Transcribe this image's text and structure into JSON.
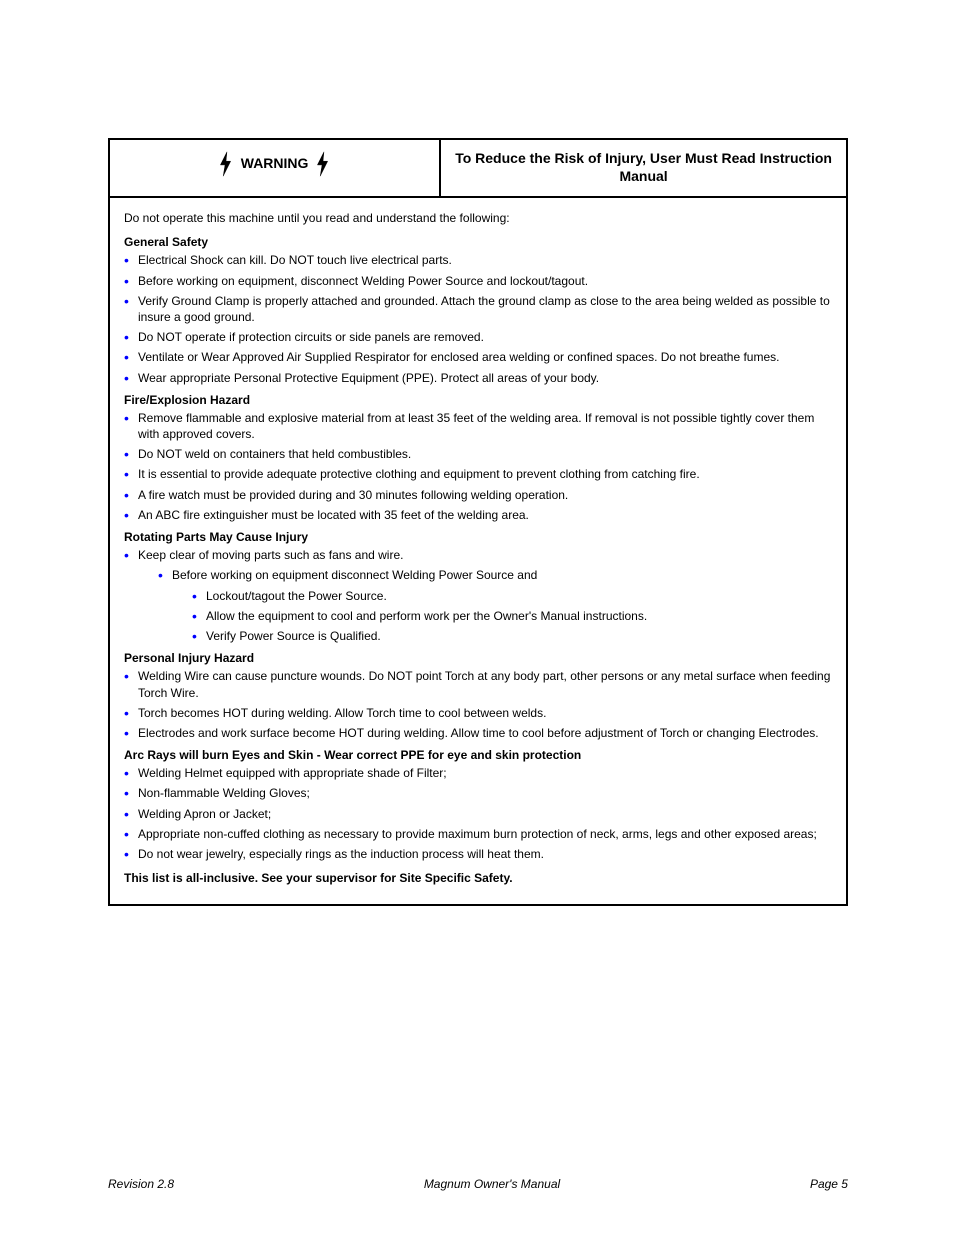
{
  "header": {
    "warning_label": "WARNING",
    "right_label": "To Reduce the Risk of Injury, User Must Read Instruction Manual"
  },
  "intro": "Do not operate this machine until you read and understand the following:",
  "section_general": {
    "title": "General Safety",
    "items": [
      "Electrical Shock can kill. Do NOT touch live electrical parts.",
      "Before working on equipment, disconnect Welding Power Source and lockout/tagout.",
      "Verify Ground Clamp is properly attached and grounded. Attach the ground clamp as close to the area being welded as possible to insure a good ground.",
      "Do NOT operate if protection circuits or side panels are removed.",
      "Ventilate or Wear Approved Air Supplied Respirator for enclosed area welding or confined spaces. Do not breathe fumes.",
      "Wear appropriate Personal Protective Equipment (PPE). Protect all areas of your body."
    ]
  },
  "section_fire": {
    "title": "Fire/Explosion Hazard",
    "items": [
      "Remove flammable and explosive material from at least 35 feet of the welding area. If removal is not possible tightly cover them with approved covers.",
      "Do NOT weld on containers that held combustibles.",
      "It is essential to provide adequate protective clothing and equipment to prevent clothing from catching fire.",
      "A fire watch must be provided during and 30 minutes following welding operation.",
      "An ABC fire extinguisher must be located with 35 feet of the welding area."
    ]
  },
  "section_rotating": {
    "title": "Rotating Parts May Cause Injury",
    "sub": {
      "item": "Keep clear of moving parts such as fans and wire.",
      "item_nested": "Before working on equipment disconnect Welding Power Source and",
      "subitems": [
        "Lockout/tagout the Power Source.",
        "Allow the equipment to cool and perform work per the Owner's Manual instructions.",
        "Verify Power Source is Qualified."
      ]
    }
  },
  "section_injury": {
    "title": "Personal Injury Hazard",
    "items": [
      "Welding Wire can cause puncture wounds. Do NOT point Torch at any body part, other persons or any metal surface when feeding Torch Wire.",
      "Torch becomes HOT during welding. Allow Torch time to cool between welds.",
      "Electrodes and work surface become HOT during welding. Allow time to cool before adjustment of Torch or changing Electrodes."
    ]
  },
  "section_ppe": {
    "title": "Arc Rays will burn Eyes and Skin - Wear correct PPE for eye and skin protection",
    "items": [
      "Welding Helmet equipped with appropriate shade of Filter;",
      "Non-flammable Welding Gloves;",
      "Welding Apron or Jacket;",
      "Appropriate non-cuffed clothing as necessary to provide maximum burn protection of neck, arms, legs and other exposed areas;",
      "Do not wear jewelry, especially rings as the induction process will heat them."
    ]
  },
  "closing": "This list is all-inclusive. See your supervisor for Site Specific Safety.",
  "footer": {
    "left": "Revision 2.8",
    "center": "Magnum Owner's Manual",
    "right": "Page 5"
  }
}
